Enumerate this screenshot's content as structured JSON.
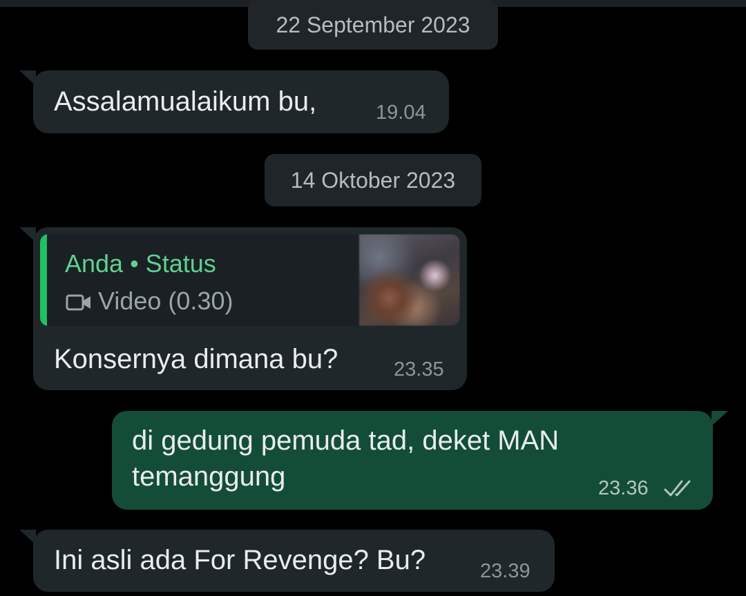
{
  "chat": {
    "dates": [
      "22 September 2023",
      "14 Oktober 2023"
    ],
    "messages": [
      {
        "direction": "incoming",
        "text": "Assalamualaikum bu,",
        "time": "19.04"
      },
      {
        "direction": "incoming",
        "quote": {
          "author": "Anda • Status",
          "media_icon": "video-camera-icon",
          "media_label": "Video (0.30)"
        },
        "text": "Konsernya dimana bu?",
        "time": "23.35"
      },
      {
        "direction": "outgoing",
        "lines": [
          "di gedung pemuda tad, deket MAN",
          "temanggung"
        ],
        "time": "23.36",
        "status_icon": "double-check-icon"
      },
      {
        "direction": "incoming",
        "text": "Ini asli ada For Revenge? Bu?",
        "time": "23.39"
      }
    ]
  },
  "colors": {
    "background": "#000000",
    "incoming_bubble": "#1f272a",
    "outgoing_bubble": "#144d37",
    "date_chip": "#1f2529",
    "quote_accent": "#21c063",
    "quote_author": "#5fd18f"
  }
}
